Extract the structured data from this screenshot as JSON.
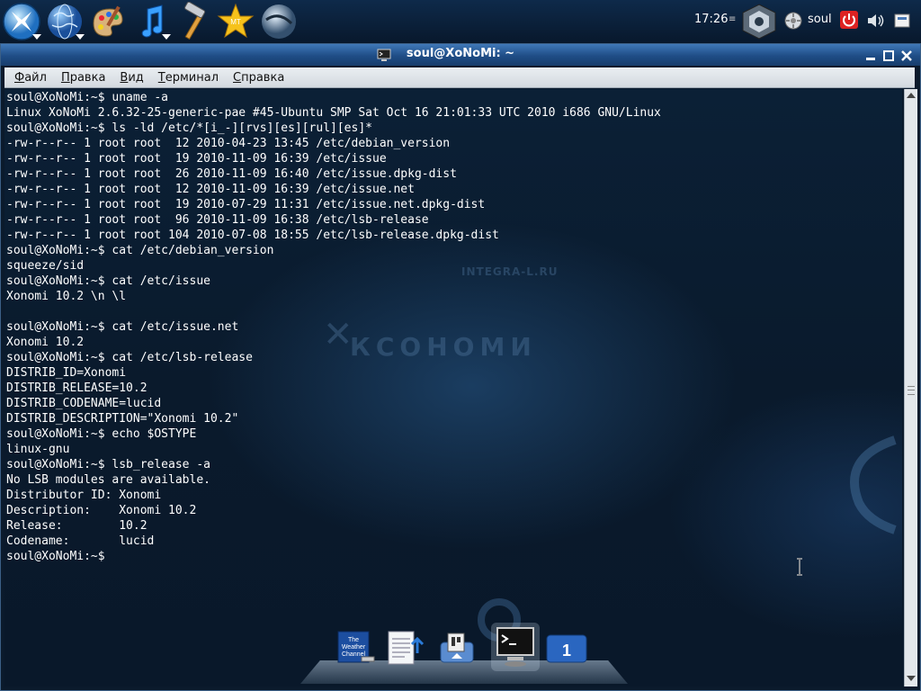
{
  "panel": {
    "clock": "17:26",
    "clock_menu": "≡",
    "user": "soul",
    "launchers": [
      "kde-menu-icon",
      "globe-icon",
      "palette-icon",
      "music-note-icon",
      "hammer-icon",
      "star-icon",
      "sphere-icon"
    ]
  },
  "window": {
    "title": "soul@XoNoMi: ~",
    "menu": [
      {
        "label": "Файл",
        "accel": "Ф",
        "rest": "айл"
      },
      {
        "label": "Правка",
        "accel": "П",
        "rest": "равка"
      },
      {
        "label": "Вид",
        "accel": "В",
        "rest": "ид"
      },
      {
        "label": "Терминал",
        "accel": "Т",
        "rest": "ерминал"
      },
      {
        "label": "Справка",
        "accel": "С",
        "rest": "правка"
      }
    ]
  },
  "terminal": {
    "lines": [
      "soul@XoNoMi:~$ uname -a",
      "Linux XoNoMi 2.6.32-25-generic-pae #45-Ubuntu SMP Sat Oct 16 21:01:33 UTC 2010 i686 GNU/Linux",
      "soul@XoNoMi:~$ ls -ld /etc/*[i_-][rvs][es][rul][es]*",
      "-rw-r--r-- 1 root root  12 2010-04-23 13:45 /etc/debian_version",
      "-rw-r--r-- 1 root root  19 2010-11-09 16:39 /etc/issue",
      "-rw-r--r-- 1 root root  26 2010-11-09 16:40 /etc/issue.dpkg-dist",
      "-rw-r--r-- 1 root root  12 2010-11-09 16:39 /etc/issue.net",
      "-rw-r--r-- 1 root root  19 2010-07-29 11:31 /etc/issue.net.dpkg-dist",
      "-rw-r--r-- 1 root root  96 2010-11-09 16:38 /etc/lsb-release",
      "-rw-r--r-- 1 root root 104 2010-07-08 18:55 /etc/lsb-release.dpkg-dist",
      "soul@XoNoMi:~$ cat /etc/debian_version",
      "squeeze/sid",
      "soul@XoNoMi:~$ cat /etc/issue",
      "Xonomi 10.2 \\n \\l",
      "",
      "soul@XoNoMi:~$ cat /etc/issue.net",
      "Xonomi 10.2",
      "soul@XoNoMi:~$ cat /etc/lsb-release",
      "DISTRIB_ID=Xonomi",
      "DISTRIB_RELEASE=10.2",
      "DISTRIB_CODENAME=lucid",
      "DISTRIB_DESCRIPTION=\"Xonomi 10.2\"",
      "soul@XoNoMi:~$ echo $OSTYPE",
      "linux-gnu",
      "soul@XoNoMi:~$ lsb_release -a",
      "No LSB modules are available.",
      "Distributor ID:\tXonomi",
      "Description:\tXonomi 10.2",
      "Release:\t10.2",
      "Codename:\tlucid",
      "soul@XoNoMi:~$ "
    ]
  },
  "wallpaper": {
    "brand": "КСОНОМИ",
    "url": "INTEGRA-L.RU"
  },
  "dock": {
    "weather_line1": "The",
    "weather_line2": "Weather",
    "weather_line3": "Channel",
    "desktop_number": "1"
  },
  "colors": {
    "terminal_text": "#ffffff",
    "titlebar": "#2a5d9a",
    "panel": "#0e2a4a"
  }
}
